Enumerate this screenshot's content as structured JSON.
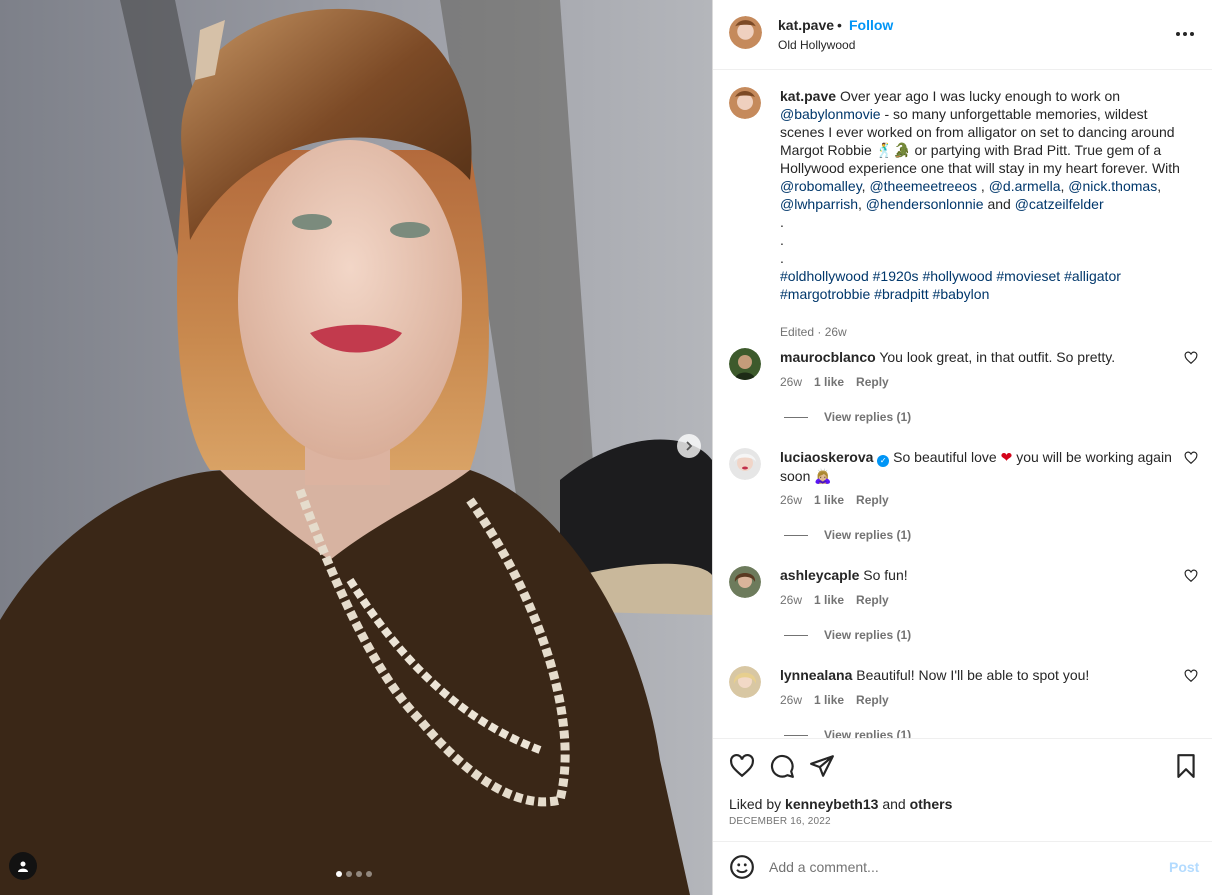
{
  "colors": {
    "follow": "#0095f6",
    "mention": "#00376b",
    "post_disabled": "#b3dbff",
    "muted": "#737373"
  },
  "carousel": {
    "slide_count": 4,
    "active_slide": 1,
    "next_icon": "chevron-right-icon",
    "tag_icon": "user-icon"
  },
  "header": {
    "username": "kat.pave",
    "separator": "•",
    "follow_label": "Follow",
    "location": "Old Hollywood",
    "more_icon": "more-horizontal-icon"
  },
  "caption": {
    "username": "kat.pave",
    "text_1": "Over year ago I was lucky enough to work on",
    "mention_1": "@babylonmovie",
    "text_2": "- so many unforgettable memories, wildest scenes I ever worked on from alligator on set to dancing around Margot Robbie 🕺🐊 or partying with Brad Pitt. True gem of a Hollywood experience one that will stay in my heart forever. With",
    "mentions": [
      "@robomalley",
      "@theemeetreeos",
      "@d.armella",
      "@nick.thomas",
      "@lwhparrish",
      "@hendersonlonnie"
    ],
    "and": "and",
    "mention_last": "@catzeilfelder",
    "dot": ".",
    "hashtags_1": "#oldhollywood #1920s #hollywood #movieset #alligator",
    "hashtags_2": "#margotrobbie #bradpitt #babylon",
    "meta": "Edited · 26w"
  },
  "comments": [
    {
      "username": "maurocblanco",
      "text": "You look great, in that outfit. So pretty.",
      "age": "26w",
      "likes": "1 like",
      "reply": "Reply",
      "view_replies": "View replies (1)"
    },
    {
      "username": "luciaoskerova",
      "text_1": "So beautiful love",
      "heart": "❤",
      "text_2": "you will be working again soon 🙇🏼‍♀️",
      "age": "26w",
      "likes": "1 like",
      "reply": "Reply",
      "view_replies": "View replies (1)"
    },
    {
      "username": "ashleycaple",
      "text": "So fun!",
      "age": "26w",
      "likes": "1 like",
      "reply": "Reply",
      "view_replies": "View replies (1)"
    },
    {
      "username": "lynnealana",
      "text": "Beautiful! Now I'll be able to spot you!",
      "age": "26w",
      "likes": "1 like",
      "reply": "Reply",
      "view_replies": "View replies (1)"
    }
  ],
  "actions": {
    "like_icon": "heart-icon",
    "comment_icon": "comment-icon",
    "share_icon": "send-icon",
    "save_icon": "bookmark-icon"
  },
  "likes": {
    "prefix": "Liked by",
    "user": "kenneybeth13",
    "and": "and",
    "others": "others"
  },
  "date": "DECEMBER 16, 2022",
  "add_comment": {
    "placeholder": "Add a comment...",
    "post_label": "Post",
    "emoji_icon": "smiley-icon"
  }
}
